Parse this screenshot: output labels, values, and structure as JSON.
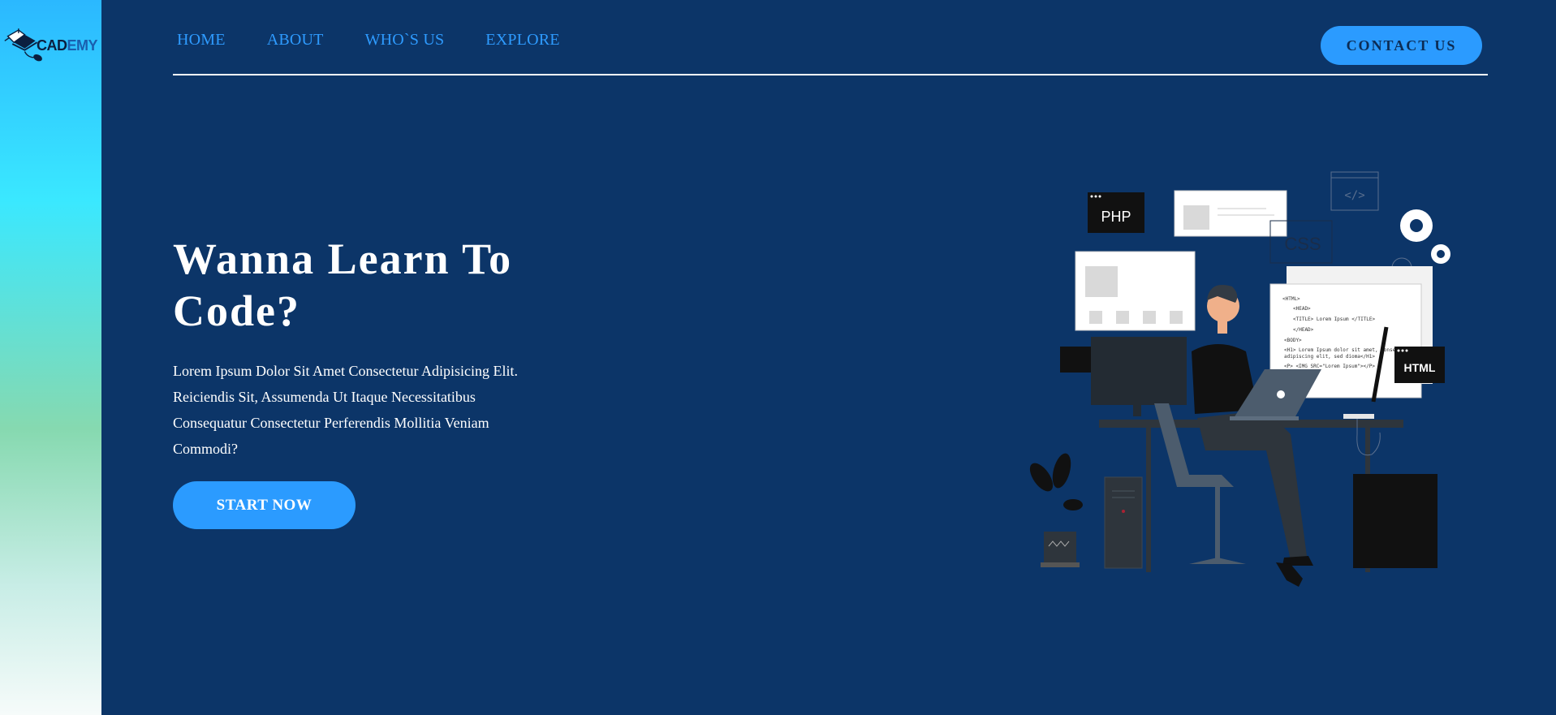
{
  "brand": {
    "logo_part1": "CAD",
    "logo_part2": "EMY"
  },
  "nav": {
    "items": [
      {
        "label": "HOME"
      },
      {
        "label": "ABOUT"
      },
      {
        "label": "WHO`S US"
      },
      {
        "label": "EXPLORE"
      }
    ],
    "contact_label": "CONTACT US"
  },
  "hero": {
    "title": "Wanna Learn To Code?",
    "description": "Lorem Ipsum Dolor Sit Amet Consectetur Adipisicing Elit. Reiciendis Sit, Assumenda Ut Itaque Necessitatibus Consequatur Consectetur Perferendis Mollitia Veniam Commodi?",
    "cta_label": "START NOW"
  },
  "illustration": {
    "php_label": "PHP",
    "css_label": "CSS",
    "html_label": "HTML",
    "code_tag": "</>",
    "code_lines": [
      "<HTML>",
      "<HEAD>",
      "<TITLE> Lorem Ipsum </TITLE>",
      "</HEAD>",
      "<BODY>",
      "<H1> Lorem Ipsum dolor sit amet, consectetur",
      "adipiscing elit, sed dioma</H1>",
      "<P> <IMG SRC=\"Lorem Ipsum\"></P>"
    ]
  },
  "colors": {
    "background": "#0c3568",
    "accent": "#2b9bff",
    "nav_link": "#2e9bff",
    "text": "#ffffff"
  }
}
